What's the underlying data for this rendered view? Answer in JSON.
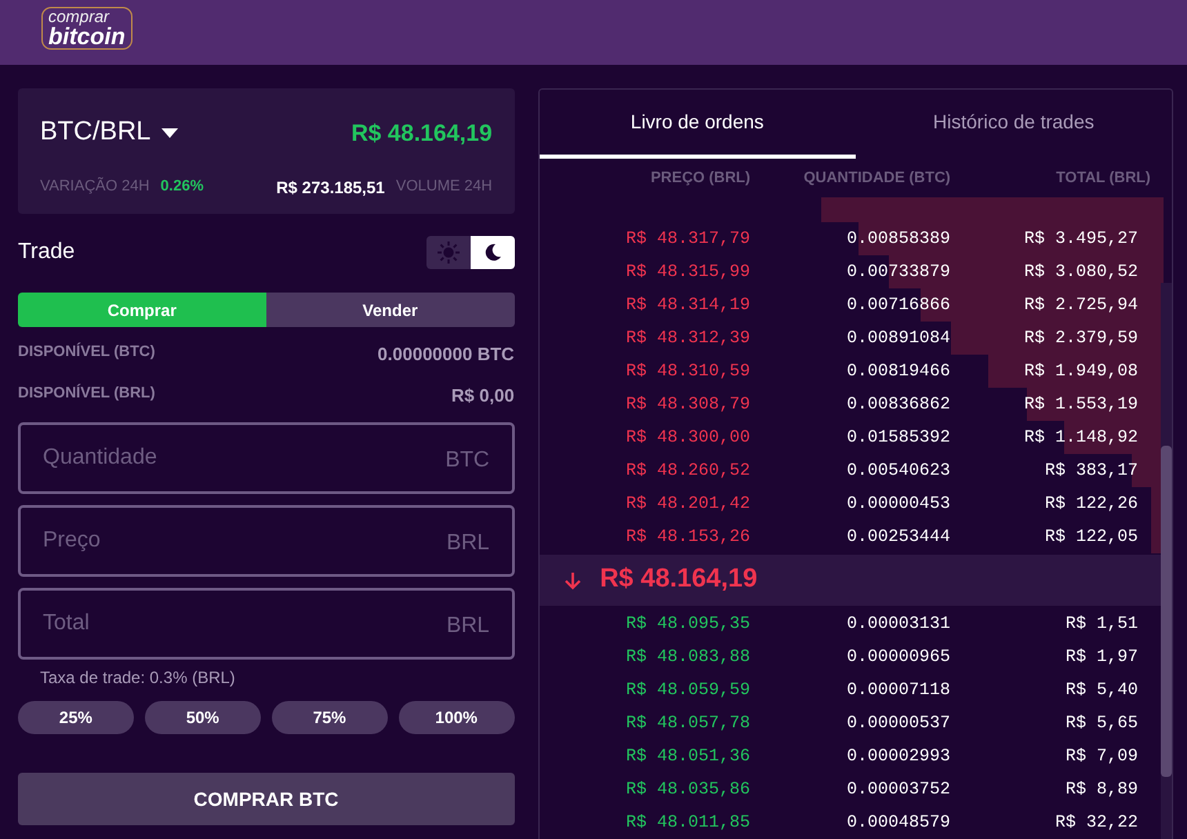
{
  "header": {
    "logo_top": "comprar",
    "logo_bottom": "bitcoin"
  },
  "market": {
    "pair": "BTC/BRL",
    "price": "R$ 48.164,19",
    "change_label": "VARIAÇÃO 24H",
    "change": "0.26%",
    "volume": "R$ 273.185,51",
    "volume_label": "VOLUME 24H"
  },
  "trade": {
    "title": "Trade",
    "theme_toggle": [
      {
        "kind": "sun",
        "selected": false
      },
      {
        "kind": "moon",
        "selected": true
      }
    ],
    "tabs": [
      {
        "label": "Comprar",
        "selected": true
      },
      {
        "label": "Vender",
        "selected": false
      }
    ],
    "balances": [
      {
        "label": "DISPONÍVEL (BTC)",
        "value": "0.00000000 BTC"
      },
      {
        "label": "DISPONÍVEL (BRL)",
        "value": "R$ 0,00"
      }
    ],
    "fields": [
      {
        "placeholder": "Quantidade",
        "unit": "BTC"
      },
      {
        "placeholder": "Preço",
        "unit": "BRL"
      },
      {
        "placeholder": "Total",
        "unit": "BRL"
      }
    ],
    "fee": "Taxa de trade: 0.3% (BRL)",
    "percent_buttons": [
      "25%",
      "50%",
      "75%",
      "100%"
    ],
    "submit": "COMPRAR BTC"
  },
  "orderbook": {
    "tabs": [
      {
        "label": "Livro de ordens",
        "selected": true
      },
      {
        "label": "Histórico de trades",
        "selected": false
      }
    ],
    "columns": [
      "PREÇO (BRL)",
      "QUANTIDADE (BTC)",
      "TOTAL (BRL)"
    ],
    "asks": [
      {
        "price": "R$ 48.317,79",
        "quantity": "0.00858389",
        "total": "R$ 3.495,27"
      },
      {
        "price": "R$ 48.315,99",
        "quantity": "0.00733879",
        "total": "R$ 3.080,52"
      },
      {
        "price": "R$ 48.314,19",
        "quantity": "0.00716866",
        "total": "R$ 2.725,94"
      },
      {
        "price": "R$ 48.312,39",
        "quantity": "0.00891084",
        "total": "R$ 2.379,59"
      },
      {
        "price": "R$ 48.310,59",
        "quantity": "0.00819466",
        "total": "R$ 1.949,08"
      },
      {
        "price": "R$ 48.308,79",
        "quantity": "0.00836862",
        "total": "R$ 1.553,19"
      },
      {
        "price": "R$ 48.300,00",
        "quantity": "0.01585392",
        "total": "R$ 1.148,92"
      },
      {
        "price": "R$ 48.260,52",
        "quantity": "0.00540623",
        "total": "R$ 383,17"
      },
      {
        "price": "R$ 48.201,42",
        "quantity": "0.00000453",
        "total": "R$ 122,26"
      },
      {
        "price": "R$ 48.153,26",
        "quantity": "0.00253444",
        "total": "R$ 122,05"
      }
    ],
    "last_price": "R$ 48.164,19",
    "bids": [
      {
        "price": "R$ 48.095,35",
        "quantity": "0.00003131",
        "total": "R$ 1,51"
      },
      {
        "price": "R$ 48.083,88",
        "quantity": "0.00000965",
        "total": "R$ 1,97"
      },
      {
        "price": "R$ 48.059,59",
        "quantity": "0.00007118",
        "total": "R$ 5,40"
      },
      {
        "price": "R$ 48.057,78",
        "quantity": "0.00000537",
        "total": "R$ 5,65"
      },
      {
        "price": "R$ 48.051,36",
        "quantity": "0.00002993",
        "total": "R$ 7,09"
      },
      {
        "price": "R$ 48.035,86",
        "quantity": "0.00003752",
        "total": "R$ 8,89"
      },
      {
        "price": "R$ 48.011,85",
        "quantity": "0.00048579",
        "total": "R$ 32,22"
      }
    ]
  }
}
